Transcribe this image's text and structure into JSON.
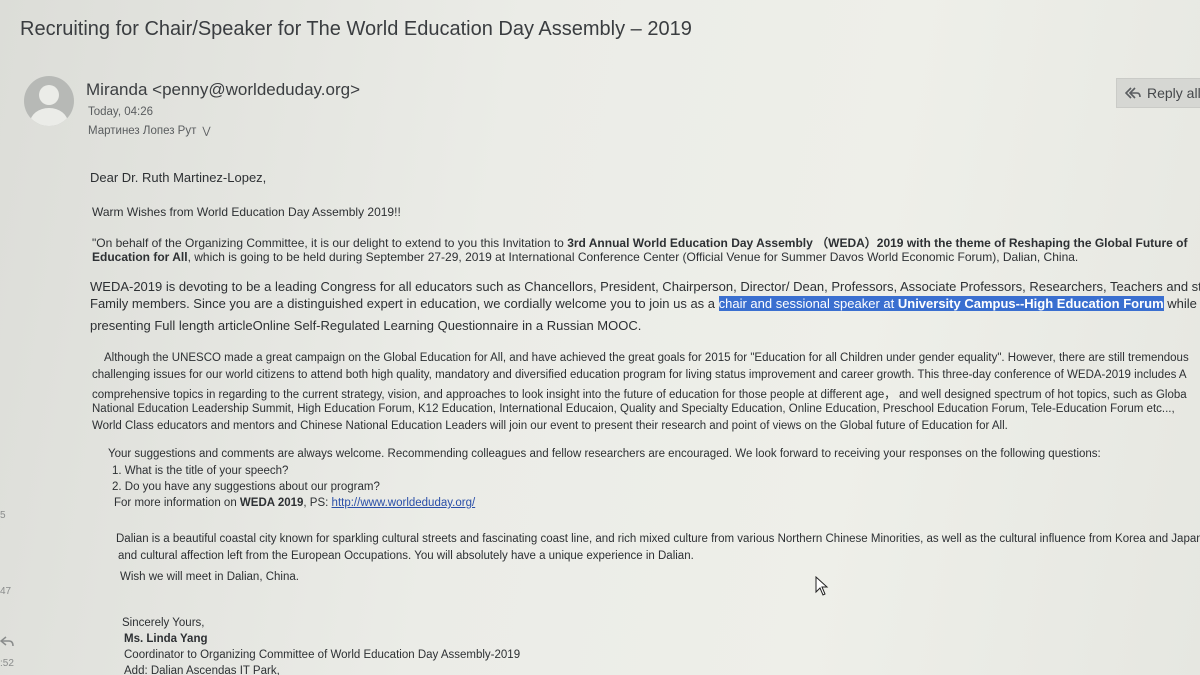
{
  "email": {
    "subject": "Recruiting for Chair/Speaker for The World Education Day Assembly – 2019",
    "sender": "Miranda <penny@worldeduday.org>",
    "timestamp": "Today, 04:26",
    "recipient": "Мартинез Лопез Рут",
    "reply_all_label": "Reply all"
  },
  "body": {
    "greeting": "Dear Dr. Ruth Martinez-Lopez,",
    "warm_wishes": "Warm Wishes from World Education Day Assembly 2019!!",
    "p1_line1_a": "\"On behalf of the Organizing Committee, it is our delight to extend to you this Invitation to ",
    "p1_line1_b": "3rd Annual World Education Day Assembly （WEDA）2019 with the theme of Reshaping the Global Future of",
    "p1_line2_a": "Education for All",
    "p1_line2_b": ", which is going to be held during September 27-29, 2019 at International Conference Center (Official Venue for Summer Davos World Economic Forum), Dalian, China.",
    "p2_line1": "WEDA-2019 is devoting to be a leading Congress for all educators such as Chancellors, President, Chairperson, Director/ Dean, Professors, Associate Professors, Researchers, Teachers and student",
    "p2_line2_a": "Family members. Since you are a distinguished expert in education, we cordially welcome you to join us as a ",
    "p2_line2_hl": "chair and sessional speaker at ",
    "p2_line2_hl_bold": "University Campus--High Education Forum",
    "p2_line2_c": " while",
    "p2_line3": "presenting Full length articleOnline Self-Regulated Learning Questionnaire in a Russian MOOC.",
    "p3_line1": "Although the UNESCO made a great campaign on the Global Education for All, and have achieved the great goals for 2015 for \"Education for all Children under gender equality\". However, there are still tremendous",
    "p3_line2": "challenging issues for our world citizens to attend both high quality, mandatory and diversified education program for living status improvement and career growth. This three-day conference of WEDA-2019 includes A",
    "p3_line3": "comprehensive topics in regarding to the current strategy, vision, and approaches to look insight into the future of education for those people at different age，  and well designed spectrum of hot topics, such as Globa",
    "p3_line4": "National Education Leadership Summit, High Education Forum, K12 Education, International Educaion, Quality and Specialty Education, Online Education, Preschool Education Forum, Tele-Education Forum etc...,",
    "p3_line5": "World Class educators and mentors and Chinese National Education Leaders will join our event to present their research and point of views on the Global future of Education for All.",
    "p4_line1": "Your suggestions and comments are always welcome. Recommending colleagues and fellow researchers are encouraged. We look forward to receiving your responses on the following questions:",
    "p4_line2": "1. What is the title of your speech?",
    "p4_line3": "2. Do you have any suggestions about our program?",
    "p4_line4_a": "For more information on ",
    "p4_line4_b": "WEDA 2019",
    "p4_line4_c": ", PS: ",
    "p4_link": "http://www.worldeduday.org/",
    "p5_line1": "Dalian is a beautiful coastal city known for sparkling cultural streets and fascinating coast line,  and rich mixed culture from various Northern Chinese Minorities, as well as the cultural influence from Korea and Japan",
    "p5_line2": "and cultural affection left from the European Occupations. You will absolutely have a unique experience in Dalian.",
    "p6": "Wish we will meet in Dalian, China.",
    "sig_close": "Sincerely Yours,",
    "sig_name": "Ms. Linda Yang",
    "sig_title": "Coordinator to Organizing Committee of World Education Day Assembly-2019",
    "sig_addr": "Add: Dalian Ascendas IT Park,"
  },
  "margin": {
    "m1": "5",
    "m2": "47",
    "m3": ":52"
  },
  "colors": {
    "selection": "#3a6fd0",
    "link": "#2a4fa8",
    "background": "#e6e7e1"
  }
}
